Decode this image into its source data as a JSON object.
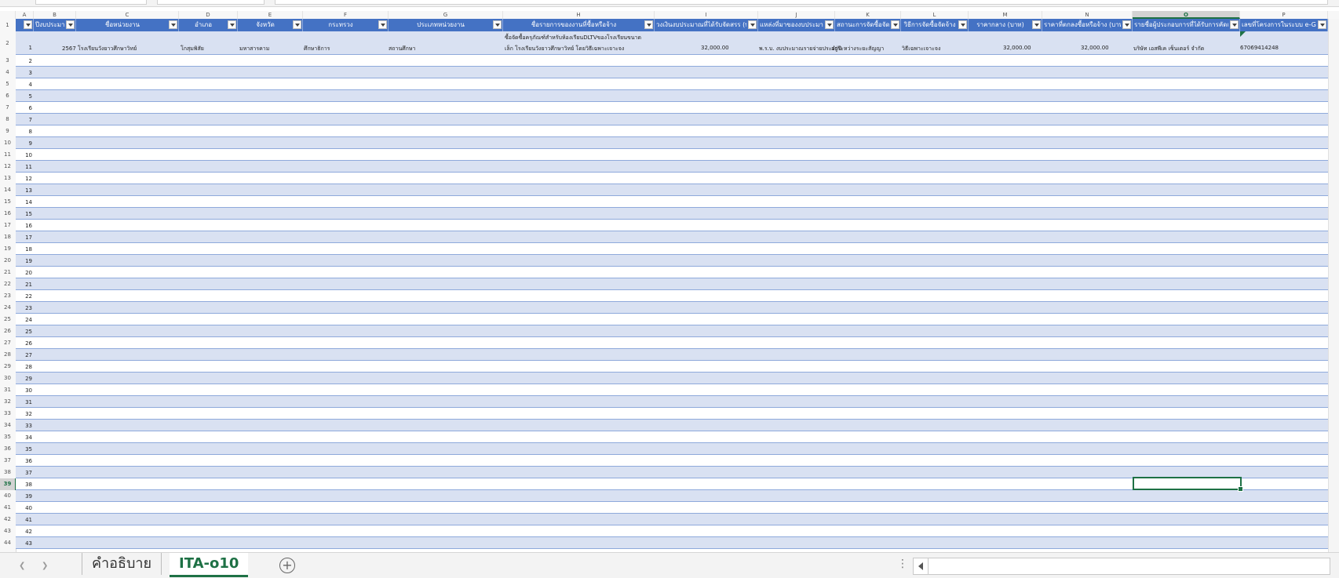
{
  "column_letters": [
    "A",
    "B",
    "C",
    "D",
    "E",
    "F",
    "G",
    "H",
    "I",
    "J",
    "K",
    "L",
    "M",
    "N",
    "O",
    "P"
  ],
  "selected_column": "O",
  "header_row_number": "1",
  "headers": [
    {
      "col": "A",
      "label": ""
    },
    {
      "col": "B",
      "label": "ปีงบประมาณ"
    },
    {
      "col": "C",
      "label": "ชื่อหน่วยงาน"
    },
    {
      "col": "D",
      "label": "อำเภอ"
    },
    {
      "col": "E",
      "label": "จังหวัด"
    },
    {
      "col": "F",
      "label": "กระทรวง"
    },
    {
      "col": "G",
      "label": "ประเภทหน่วยงาน"
    },
    {
      "col": "H",
      "label": "ชื่อรายการของงานที่ซื้อหรือจ้าง"
    },
    {
      "col": "I",
      "label": "วงเงินงบประมาณที่ได้รับจัดสรร (บาท)"
    },
    {
      "col": "J",
      "label": "แหล่งที่มาของงบประมาณ"
    },
    {
      "col": "K",
      "label": "สถานะการจัดซื้อจัดจ้าง"
    },
    {
      "col": "L",
      "label": "วิธีการจัดซื้อจัดจ้าง"
    },
    {
      "col": "M",
      "label": "ราคากลาง (บาท)"
    },
    {
      "col": "N",
      "label": "ราคาที่ตกลงซื้อหรือจ้าง (บาท)"
    },
    {
      "col": "O",
      "label": "รายชื่อผู้ประกอบการที่ได้รับการคัดเลือก"
    },
    {
      "col": "P",
      "label": "เลขที่โครงการในระบบ e-GP"
    }
  ],
  "first_record": {
    "row_number": "2",
    "a": "1",
    "b_year_org": "2567 โรงเรียนวังยาวศึกษาวิทย์",
    "d_district": "โกสุมพิสัย",
    "e_province": "มหาสารคาม",
    "f_ministry": "ศึกษาธิการ",
    "g_type": "สถานศึกษา",
    "h_line1": "ซื้อจัดซื้อครุภัณฑ์สำหรับห้องเรียนDLTVของโรงเรียนขนาด",
    "h_line2": "เล็ก โรงเรียนวังยาวศึกษาวิทย์ โดยวิธีเฉพาะเจาะจง",
    "i_budget": "32,000.00",
    "j_source": "พ.ร.บ. งบประมาณรายจ่ายประจำปี",
    "k_status": "อยู่ระหว่างระยะสัญญา",
    "l_method": "วิธีเฉพาะเจาะจง",
    "m_median": "32,000.00",
    "n_price": "32,000.00",
    "o_vendor": "บริษัท เอสพีเค เซ็นเตอร์ จำกัด",
    "p_project": "67069414248"
  },
  "empty_rows": [
    {
      "row": "3",
      "a": "2"
    },
    {
      "row": "4",
      "a": "3"
    },
    {
      "row": "5",
      "a": "4"
    },
    {
      "row": "6",
      "a": "5"
    },
    {
      "row": "7",
      "a": "6"
    },
    {
      "row": "8",
      "a": "7"
    },
    {
      "row": "9",
      "a": "8"
    },
    {
      "row": "10",
      "a": "9"
    },
    {
      "row": "11",
      "a": "10"
    },
    {
      "row": "12",
      "a": "11"
    },
    {
      "row": "13",
      "a": "12"
    },
    {
      "row": "14",
      "a": "13"
    },
    {
      "row": "15",
      "a": "14"
    },
    {
      "row": "16",
      "a": "15"
    },
    {
      "row": "17",
      "a": "16"
    },
    {
      "row": "18",
      "a": "17"
    },
    {
      "row": "19",
      "a": "18"
    },
    {
      "row": "20",
      "a": "19"
    },
    {
      "row": "21",
      "a": "20"
    },
    {
      "row": "22",
      "a": "21"
    },
    {
      "row": "23",
      "a": "22"
    },
    {
      "row": "24",
      "a": "23"
    },
    {
      "row": "25",
      "a": "24"
    },
    {
      "row": "26",
      "a": "25"
    },
    {
      "row": "27",
      "a": "26"
    },
    {
      "row": "28",
      "a": "27"
    },
    {
      "row": "29",
      "a": "28"
    },
    {
      "row": "30",
      "a": "29"
    },
    {
      "row": "31",
      "a": "30"
    },
    {
      "row": "32",
      "a": "31"
    },
    {
      "row": "33",
      "a": "32"
    },
    {
      "row": "34",
      "a": "33"
    },
    {
      "row": "35",
      "a": "34"
    },
    {
      "row": "36",
      "a": "35"
    },
    {
      "row": "37",
      "a": "36"
    },
    {
      "row": "38",
      "a": "37"
    },
    {
      "row": "39",
      "a": "38"
    },
    {
      "row": "40",
      "a": "39"
    },
    {
      "row": "41",
      "a": "40"
    },
    {
      "row": "42",
      "a": "41"
    },
    {
      "row": "43",
      "a": "42"
    },
    {
      "row": "44",
      "a": "43"
    }
  ],
  "selected_row": "39",
  "sheet_tabs": [
    {
      "label": "คำอธิบาย",
      "active": false
    },
    {
      "label": "ITA-o10",
      "active": true
    }
  ],
  "icons": {
    "tab_prev": "chevron-left-icon",
    "tab_next": "chevron-right-icon",
    "add_sheet": "plus-circle-icon",
    "more": "vertical-dots-icon",
    "scroll_left": "triangle-left-icon",
    "filter": "dropdown-filter-icon"
  },
  "colors": {
    "header_bg": "#4472c4",
    "band_bg": "#d9e1f2",
    "accent_green": "#1e7145"
  }
}
